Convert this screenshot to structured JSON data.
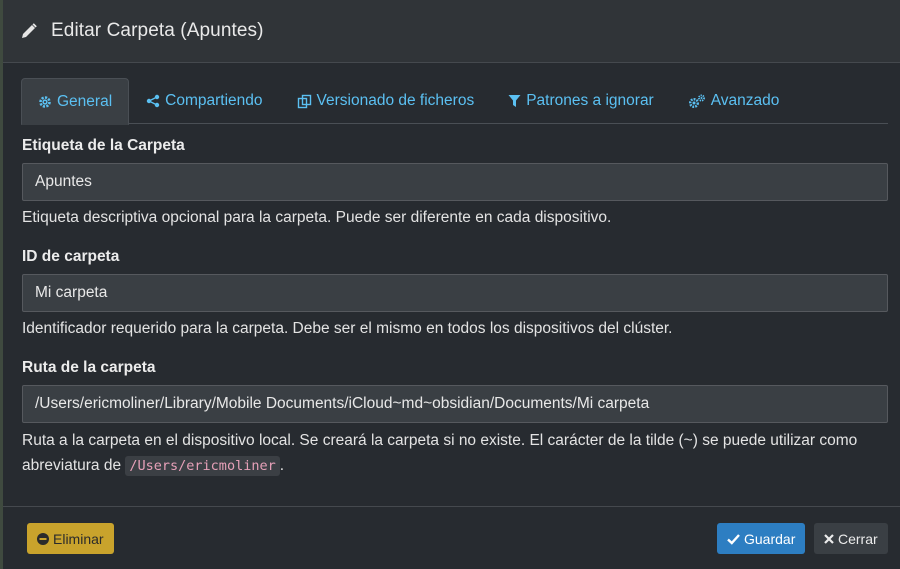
{
  "header": {
    "title": "Editar Carpeta (Apuntes)",
    "icon": "pencil-icon"
  },
  "tabs": [
    {
      "label": "General",
      "icon": "gear-icon",
      "active": true
    },
    {
      "label": "Compartiendo",
      "icon": "share-icon",
      "active": false
    },
    {
      "label": "Versionado de ficheros",
      "icon": "copy-icon",
      "active": false
    },
    {
      "label": "Patrones a ignorar",
      "icon": "filter-icon",
      "active": false
    },
    {
      "label": "Avanzado",
      "icon": "gears-icon",
      "active": false
    }
  ],
  "fields": {
    "label": {
      "title": "Etiqueta de la Carpeta",
      "value": "Apuntes",
      "help": "Etiqueta descriptiva opcional para la carpeta. Puede ser diferente en cada dispositivo."
    },
    "id": {
      "title": "ID de carpeta",
      "value": "Mi carpeta",
      "help": "Identificador requerido para la carpeta. Debe ser el mismo en todos los dispositivos del clúster."
    },
    "path": {
      "title": "Ruta de la carpeta",
      "value": "/Users/ericmoliner/Library/Mobile Documents/iCloud~md~obsidian/Documents/Mi carpeta",
      "help_part1": "Ruta a la carpeta en el dispositivo local. Se creará la carpeta si no existe. El carácter de la tilde (~) se puede utilizar como abreviatura de ",
      "help_code": "/Users/ericmoliner",
      "help_part2": "."
    }
  },
  "footer": {
    "delete_label": "Eliminar",
    "save_label": "Guardar",
    "close_label": "Cerrar"
  },
  "colors": {
    "link": "#5bc0f2",
    "warning": "#c9a32c",
    "primary": "#2d7ec2",
    "background": "#272b30"
  }
}
